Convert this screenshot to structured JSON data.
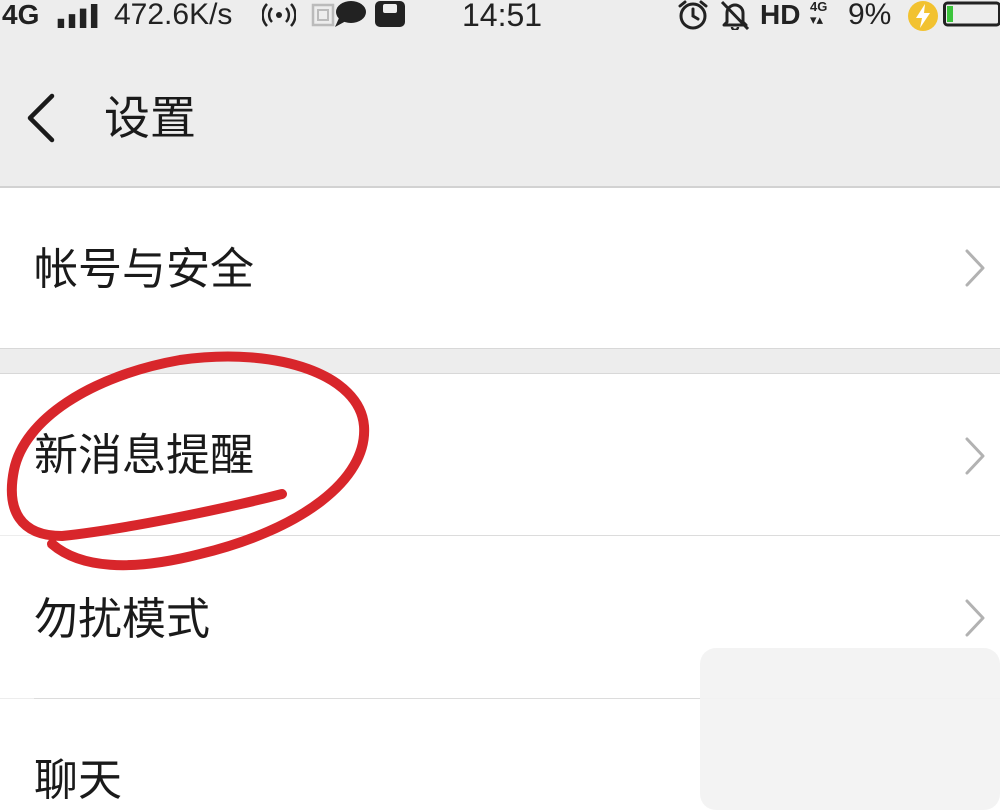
{
  "status_bar": {
    "network_type": "4G",
    "net_speed": "472.6K/s",
    "time": "14:51",
    "hd_label": "HD",
    "secondary_network": "4G",
    "battery_percent": "9%",
    "battery_level": 0.09,
    "icons": [
      "signal-bars-icon",
      "hotspot-icon",
      "sim-box-icon",
      "chat-bubble-icon",
      "note-icon",
      "alarm-icon",
      "mute-bell-icon",
      "charging-bolt-icon",
      "battery-icon"
    ]
  },
  "header": {
    "back_icon": "chevron-left-icon",
    "title": "设置"
  },
  "settings": {
    "items": [
      {
        "label": "帐号与安全",
        "icon": "chevron-right-icon"
      },
      {
        "label": "新消息提醒",
        "icon": "chevron-right-icon"
      },
      {
        "label": "勿扰模式",
        "icon": "chevron-right-icon"
      },
      {
        "label": "聊天",
        "icon": "chevron-right-icon"
      }
    ]
  },
  "colors": {
    "background": "#ededed",
    "row_background": "#ffffff",
    "annotation_red": "#d8262b",
    "charge_yellow": "#f2c230",
    "battery_green": "#3cc43c"
  }
}
